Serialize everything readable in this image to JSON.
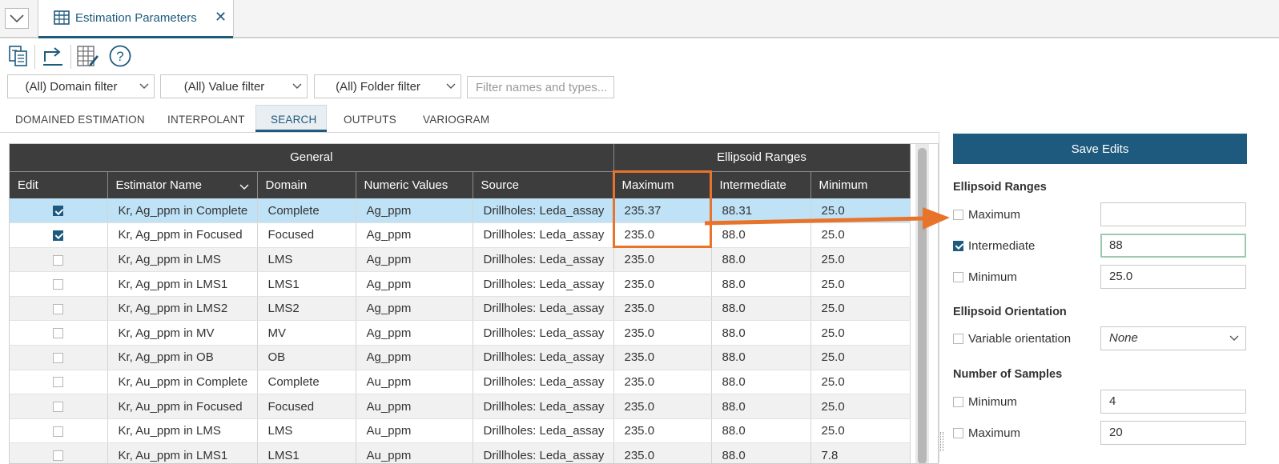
{
  "tab": {
    "title": "Estimation Parameters"
  },
  "toolbar": {
    "icons": [
      "copy-icon",
      "export-icon",
      "edit-table-icon",
      "help-icon"
    ]
  },
  "filters": {
    "domain": "(All) Domain filter",
    "value": "(All) Value filter",
    "folder": "(All) Folder filter",
    "search_placeholder": "Filter names and types..."
  },
  "param_tabs": [
    "DOMAINED ESTIMATION",
    "INTERPOLANT",
    "SEARCH",
    "OUTPUTS",
    "VARIOGRAM"
  ],
  "active_param_tab": "SEARCH",
  "grid": {
    "groups": [
      "General",
      "Ellipsoid Ranges"
    ],
    "columns": [
      "Edit",
      "Estimator Name",
      "Domain",
      "Numeric Values",
      "Source",
      "Maximum",
      "Intermediate",
      "Minimum"
    ],
    "rows": [
      {
        "edit": true,
        "name": "Kr, Ag_ppm in Complete",
        "domain": "Complete",
        "numeric": "Ag_ppm",
        "source": "Drillholes: Leda_assay",
        "max": "235.37",
        "int": "88.31",
        "min": "25.0"
      },
      {
        "edit": true,
        "name": "Kr, Ag_ppm in Focused",
        "domain": "Focused",
        "numeric": "Ag_ppm",
        "source": "Drillholes: Leda_assay",
        "max": "235.0",
        "int": "88.0",
        "min": "25.0"
      },
      {
        "edit": false,
        "name": "Kr, Ag_ppm in LMS",
        "domain": "LMS",
        "numeric": "Ag_ppm",
        "source": "Drillholes: Leda_assay",
        "max": "235.0",
        "int": "88.0",
        "min": "25.0"
      },
      {
        "edit": false,
        "name": "Kr, Ag_ppm in LMS1",
        "domain": "LMS1",
        "numeric": "Ag_ppm",
        "source": "Drillholes: Leda_assay",
        "max": "235.0",
        "int": "88.0",
        "min": "25.0"
      },
      {
        "edit": false,
        "name": "Kr, Ag_ppm in LMS2",
        "domain": "LMS2",
        "numeric": "Ag_ppm",
        "source": "Drillholes: Leda_assay",
        "max": "235.0",
        "int": "88.0",
        "min": "25.0"
      },
      {
        "edit": false,
        "name": "Kr, Ag_ppm in MV",
        "domain": "MV",
        "numeric": "Ag_ppm",
        "source": "Drillholes: Leda_assay",
        "max": "235.0",
        "int": "88.0",
        "min": "25.0"
      },
      {
        "edit": false,
        "name": "Kr, Ag_ppm in OB",
        "domain": "OB",
        "numeric": "Ag_ppm",
        "source": "Drillholes: Leda_assay",
        "max": "235.0",
        "int": "88.0",
        "min": "25.0"
      },
      {
        "edit": false,
        "name": "Kr, Au_ppm in Complete",
        "domain": "Complete",
        "numeric": "Au_ppm",
        "source": "Drillholes: Leda_assay",
        "max": "235.0",
        "int": "88.0",
        "min": "25.0"
      },
      {
        "edit": false,
        "name": "Kr, Au_ppm in Focused",
        "domain": "Focused",
        "numeric": "Au_ppm",
        "source": "Drillholes: Leda_assay",
        "max": "235.0",
        "int": "88.0",
        "min": "25.0"
      },
      {
        "edit": false,
        "name": "Kr, Au_ppm in LMS",
        "domain": "LMS",
        "numeric": "Au_ppm",
        "source": "Drillholes: Leda_assay",
        "max": "235.0",
        "int": "88.0",
        "min": "25.0"
      },
      {
        "edit": false,
        "name": "Kr, Au_ppm in LMS1",
        "domain": "LMS1",
        "numeric": "Au_ppm",
        "source": "Drillholes: Leda_assay",
        "max": "235.0",
        "int": "88.0",
        "min": "7.8"
      }
    ]
  },
  "panel": {
    "save_label": "Save Edits",
    "ellipsoid_ranges": {
      "title": "Ellipsoid Ranges",
      "maximum": {
        "label": "Maximum",
        "checked": false,
        "value": ""
      },
      "intermediate": {
        "label": "Intermediate",
        "checked": true,
        "value": "88"
      },
      "minimum": {
        "label": "Minimum",
        "checked": false,
        "value": "25.0"
      }
    },
    "ellipsoid_orientation": {
      "title": "Ellipsoid Orientation",
      "variable": {
        "label": "Variable orientation",
        "checked": false,
        "value": "None"
      }
    },
    "number_of_samples": {
      "title": "Number of Samples",
      "minimum": {
        "label": "Minimum",
        "checked": false,
        "value": "4"
      },
      "maximum": {
        "label": "Maximum",
        "checked": false,
        "value": "20"
      }
    }
  },
  "colors": {
    "accent": "#1e5a7e",
    "highlight": "#e8732b",
    "header": "#3d3d3d",
    "selected_row": "#bfe2f7"
  }
}
